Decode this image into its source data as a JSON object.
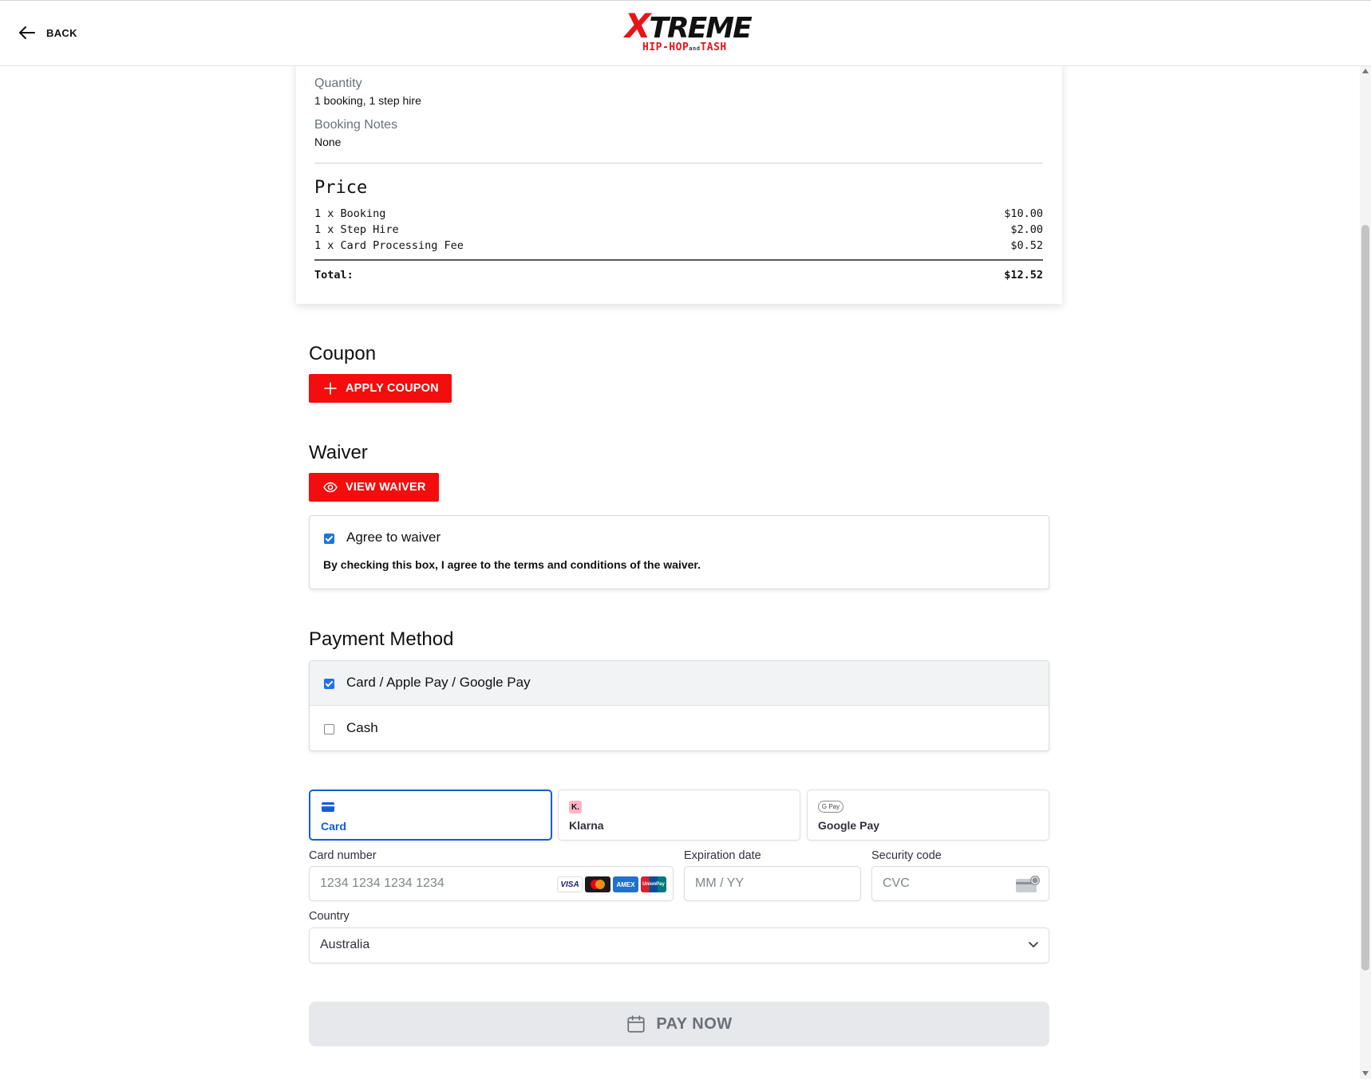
{
  "header": {
    "back_label": "BACK",
    "logo_main": "XTREME",
    "logo_main_x": "X",
    "logo_main_rest": "TREME",
    "logo_sub_left": "HIP-HOP",
    "logo_sub_mid": "and",
    "logo_sub_right": "TASH"
  },
  "summary": {
    "quantity_label": "Quantity",
    "quantity_value": "1 booking, 1 step hire",
    "notes_label": "Booking Notes",
    "notes_value": "None",
    "price_title": "Price",
    "lines": [
      {
        "desc": "1 x Booking",
        "amount": "$10.00"
      },
      {
        "desc": "1 x Step Hire",
        "amount": "$2.00"
      },
      {
        "desc": "1 x Card Processing Fee",
        "amount": "$0.52"
      }
    ],
    "total_label": "Total:",
    "total_value": "$12.52"
  },
  "coupon": {
    "title": "Coupon",
    "button_label": "APPLY COUPON"
  },
  "waiver": {
    "title": "Waiver",
    "button_label": "VIEW WAIVER",
    "agree_label": "Agree to waiver",
    "agree_checked": true,
    "terms_text": "By checking this box, I agree to the terms and conditions of the waiver."
  },
  "payment_method": {
    "title": "Payment Method",
    "options": [
      {
        "label": "Card / Apple Pay / Google Pay",
        "checked": true
      },
      {
        "label": "Cash",
        "checked": false
      }
    ]
  },
  "stripe": {
    "tabs": [
      {
        "label": "Card",
        "active": true
      },
      {
        "label": "Klarna",
        "active": false
      },
      {
        "label": "Google Pay",
        "active": false
      }
    ],
    "klarna_icon_text": "K.",
    "gpay_icon_text": "G Pay",
    "card_number_label": "Card number",
    "card_number_placeholder": "1234 1234 1234 1234",
    "card_brands": [
      "VISA",
      "mastercard",
      "AMEX",
      "UnionPay"
    ],
    "expiry_label": "Expiration date",
    "expiry_placeholder": "MM / YY",
    "cvc_label": "Security code",
    "cvc_placeholder": "CVC",
    "country_label": "Country",
    "country_value": "Australia"
  },
  "pay_button_label": "PAY NOW",
  "colors": {
    "brand_red": "#f50c0c",
    "checkbox_blue": "#1a73e8",
    "stripe_active": "#0f5fd6"
  }
}
